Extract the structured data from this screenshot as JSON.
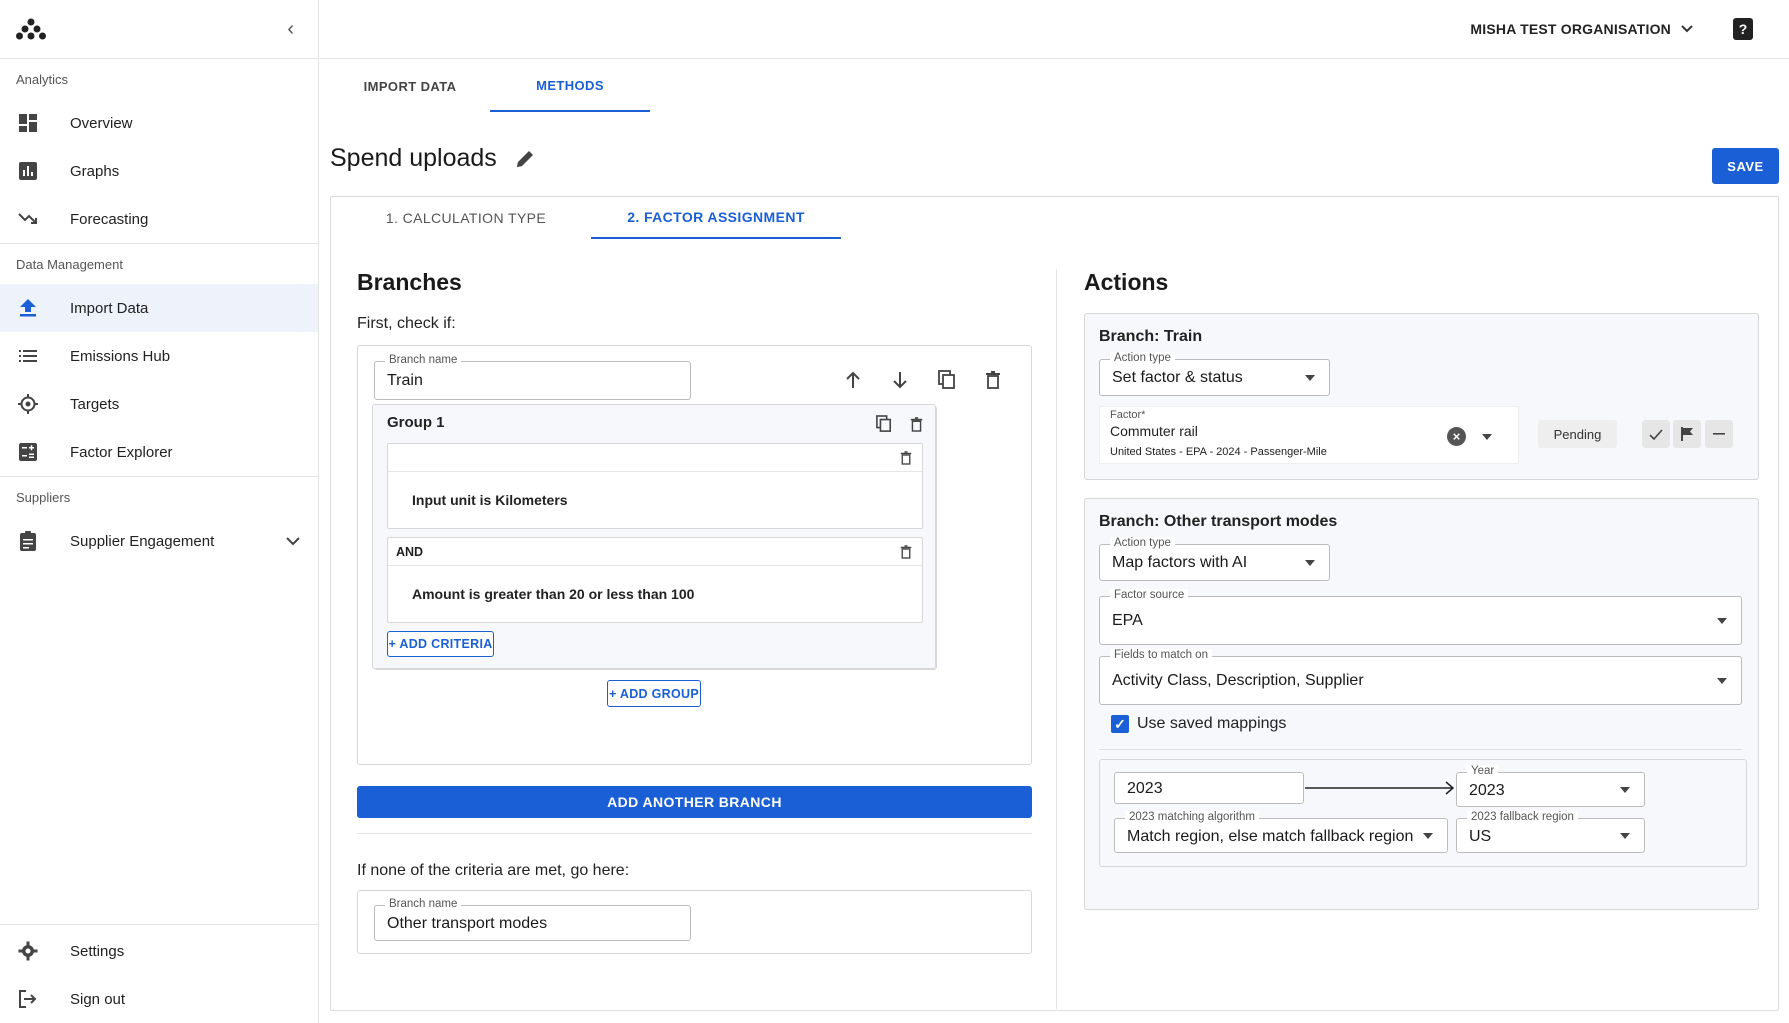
{
  "sidebar": {
    "sections": [
      {
        "label": "Analytics",
        "items": [
          {
            "label": "Overview",
            "icon": "dashboard-icon"
          },
          {
            "label": "Graphs",
            "icon": "bar-chart-icon"
          },
          {
            "label": "Forecasting",
            "icon": "trending-down-icon"
          }
        ]
      },
      {
        "label": "Data Management",
        "items": [
          {
            "label": "Import Data",
            "icon": "upload-icon",
            "active": true
          },
          {
            "label": "Emissions Hub",
            "icon": "list-icon"
          },
          {
            "label": "Targets",
            "icon": "target-icon"
          },
          {
            "label": "Factor Explorer",
            "icon": "calculator-icon"
          }
        ]
      },
      {
        "label": "Suppliers",
        "items": [
          {
            "label": "Supplier Engagement",
            "icon": "clipboard-icon"
          }
        ]
      }
    ],
    "bottom": [
      {
        "label": "Settings",
        "icon": "gear-icon"
      },
      {
        "label": "Sign out",
        "icon": "sign-out-icon"
      }
    ]
  },
  "topbar": {
    "org_name": "MISHA TEST ORGANISATION",
    "help_glyph": "?"
  },
  "top_tabs": [
    {
      "label": "IMPORT DATA",
      "active": false
    },
    {
      "label": "METHODS",
      "active": true
    }
  ],
  "page": {
    "title": "Spend uploads",
    "save_label": "SAVE"
  },
  "step_tabs": [
    {
      "label": "1. CALCULATION TYPE",
      "active": false
    },
    {
      "label": "2. FACTOR ASSIGNMENT",
      "active": true
    }
  ],
  "branches": {
    "heading": "Branches",
    "first_check": "First, check if:",
    "branch_name_label": "Branch name",
    "branch_name": "Train",
    "group_title": "Group 1",
    "criteria": [
      {
        "header": "",
        "text": "Input unit is Kilometers"
      },
      {
        "header": "AND",
        "text": "Amount is greater than 20 or less than 100"
      }
    ],
    "add_criteria": "+ ADD CRITERIA",
    "add_group": "+ ADD GROUP",
    "add_branch": "ADD ANOTHER BRANCH",
    "fallback_label": "If none of the criteria are met, go here:",
    "fallback_branch_label": "Branch name",
    "fallback_branch": "Other transport modes"
  },
  "actions": {
    "heading": "Actions",
    "train": {
      "title": "Branch: Train",
      "action_type_label": "Action type",
      "action_type": "Set factor & status",
      "factor_label": "Factor*",
      "factor_name": "Commuter rail",
      "factor_detail": "United States - EPA - 2024 - Passenger-Mile",
      "status": "Pending"
    },
    "other": {
      "title": "Branch: Other transport modes",
      "action_type_label": "Action type",
      "action_type": "Map factors with AI",
      "factor_source_label": "Factor source",
      "factor_source": "EPA",
      "fields_label": "Fields to match on",
      "fields": "Activity Class, Description, Supplier",
      "use_saved_label": "Use saved mappings",
      "input_year": "2023",
      "year_label": "Year",
      "year": "2023",
      "algorithm_label": "2023 matching algorithm",
      "algorithm": "Match region, else match fallback region",
      "fallback_region_label": "2023 fallback region",
      "fallback_region": "US"
    }
  },
  "colors": {
    "accent": "#1a5fd6",
    "active_bg": "#eef2fb"
  }
}
